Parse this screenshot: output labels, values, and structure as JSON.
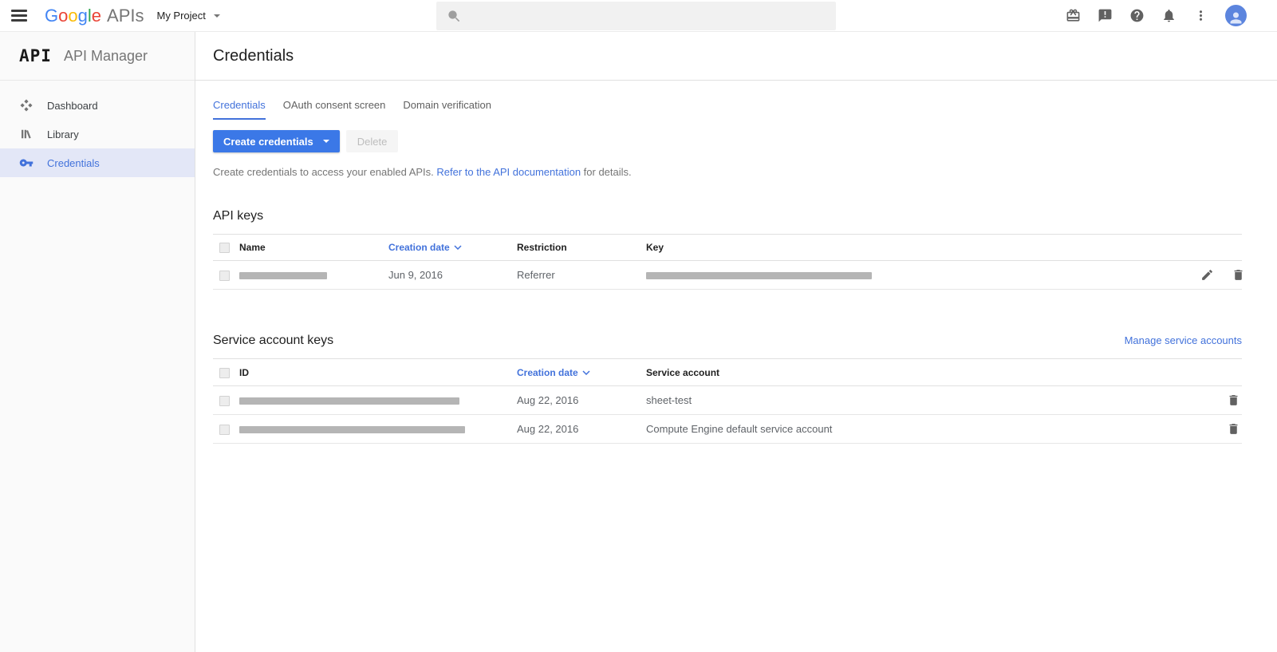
{
  "topbar": {
    "logo": {
      "letters": [
        "G",
        "o",
        "o",
        "g",
        "l",
        "e"
      ],
      "suffix": "APIs"
    },
    "project_selector": {
      "label": "My Project"
    },
    "search": {
      "placeholder": "",
      "value": ""
    }
  },
  "sidebar": {
    "logo": "API",
    "title": "API Manager",
    "items": [
      {
        "label": "Dashboard"
      },
      {
        "label": "Library"
      },
      {
        "label": "Credentials"
      }
    ]
  },
  "main": {
    "page_title": "Credentials",
    "tabs": [
      {
        "label": "Credentials"
      },
      {
        "label": "OAuth consent screen"
      },
      {
        "label": "Domain verification"
      }
    ],
    "toolbar": {
      "create_label": "Create credentials",
      "delete_label": "Delete"
    },
    "description": {
      "text_before": "Create credentials to access your enabled APIs. ",
      "link": "Refer to the API documentation",
      "text_after": " for details."
    },
    "api_keys": {
      "title": "API keys",
      "columns": {
        "name": "Name",
        "creation_date": "Creation date",
        "restriction": "Restriction",
        "key": "Key"
      },
      "rows": [
        {
          "name_redacted": true,
          "creation_date": "Jun 9, 2016",
          "restriction": "Referrer",
          "key_redacted": true
        }
      ]
    },
    "service_accounts": {
      "title": "Service account keys",
      "manage_link": "Manage service accounts",
      "columns": {
        "id": "ID",
        "creation_date": "Creation date",
        "service_account": "Service account"
      },
      "rows": [
        {
          "id_redacted": true,
          "creation_date": "Aug 22, 2016",
          "service_account": "sheet-test"
        },
        {
          "id_redacted": true,
          "creation_date": "Aug 22, 2016",
          "service_account": "Compute Engine default service account"
        }
      ]
    }
  },
  "colors": {
    "brand_blue": "#4285f4",
    "brand_red": "#ea4335",
    "brand_yellow": "#fbbc05",
    "brand_green": "#34a853",
    "button_blue": "#3b78e7",
    "link_blue": "#4272db",
    "active_item_bg": "#e3e7f7",
    "redacted_bar": "#b5b5b5"
  }
}
